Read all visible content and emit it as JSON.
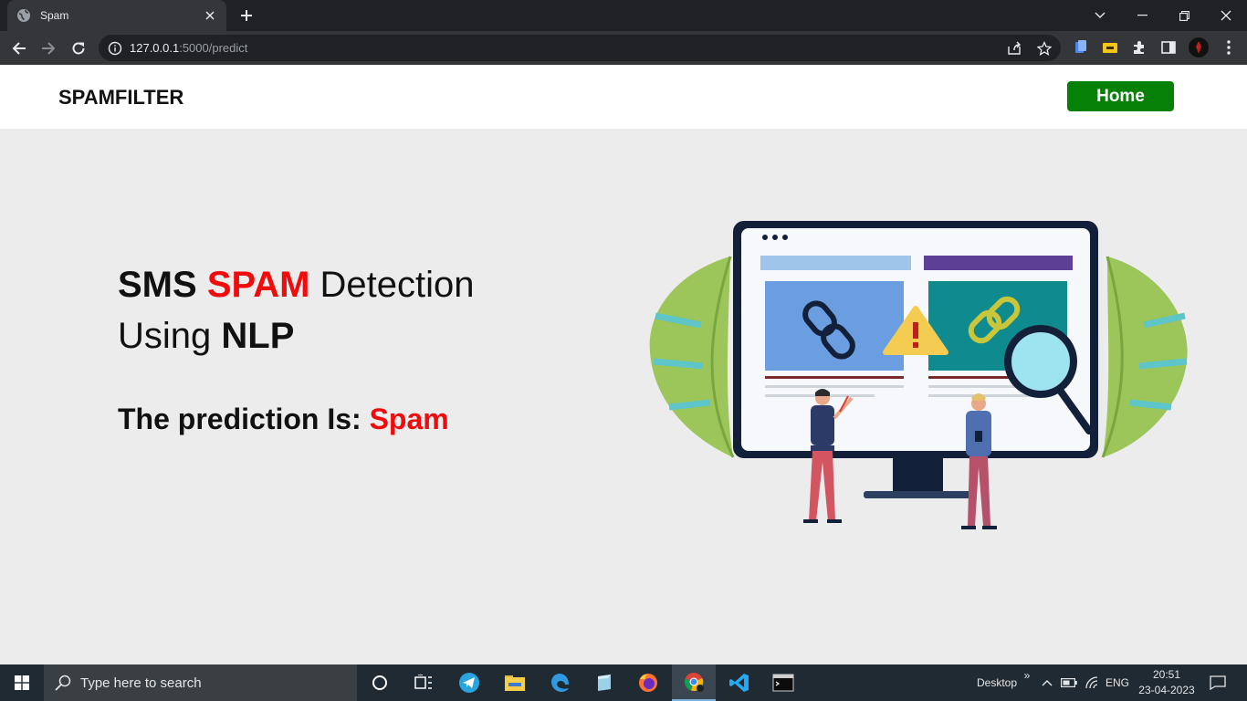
{
  "browser": {
    "tab_title": "Spam",
    "url_host": "127.0.0.1",
    "url_rest": ":5000/predict"
  },
  "navbar": {
    "brand": "SPAMFILTER",
    "home_label": "Home"
  },
  "hero": {
    "w1": "SMS",
    "w2": "SPAM",
    "w3": "Detection",
    "w4": "Using",
    "w5": "NLP",
    "prediction_label": "The prediction Is:",
    "prediction_value": "Spam"
  },
  "taskbar": {
    "search_placeholder": "Type here to search",
    "desktop_label": "Desktop",
    "language": "ENG",
    "time": "20:51",
    "date": "23-04-2023"
  },
  "colors": {
    "accent_red": "#f00c0c",
    "home_green": "#068006"
  }
}
